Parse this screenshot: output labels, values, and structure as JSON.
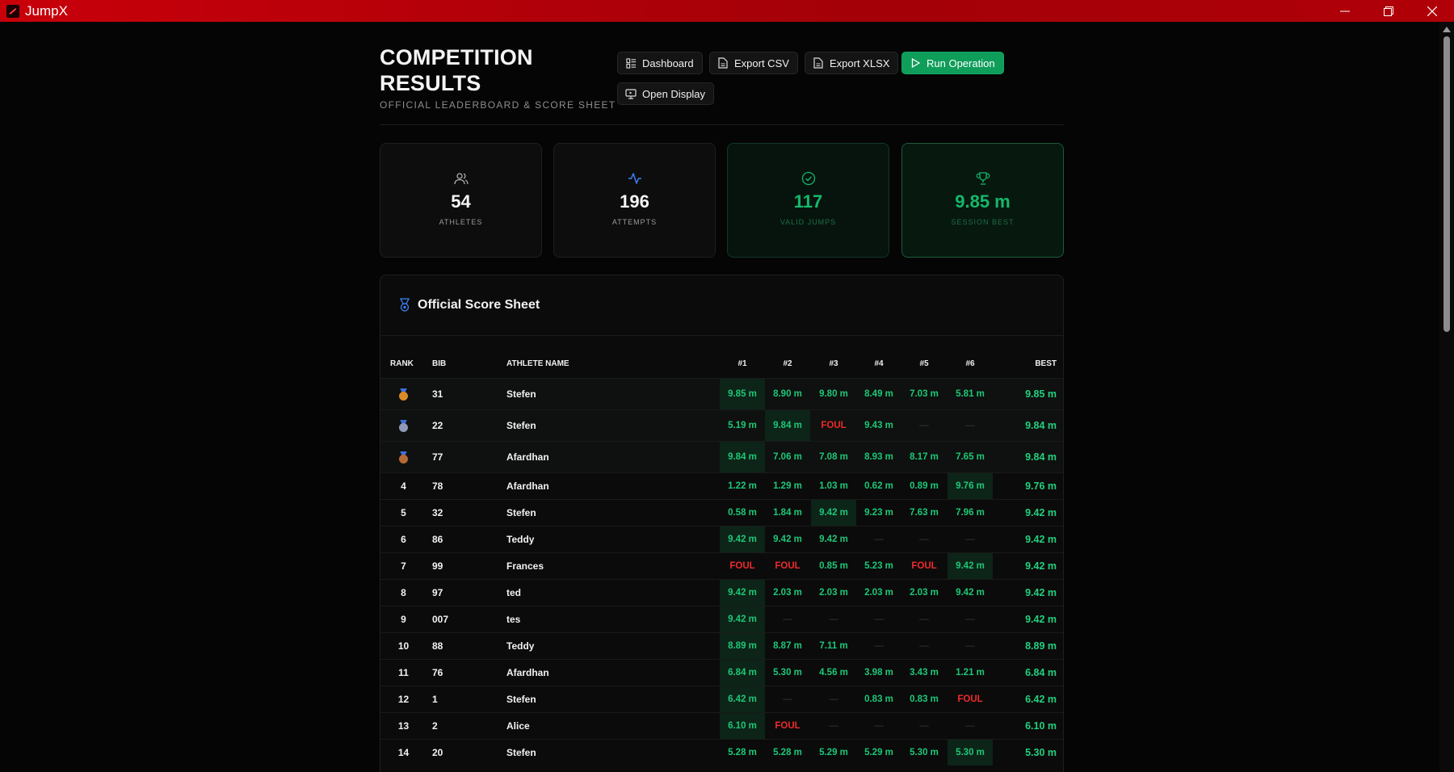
{
  "window": {
    "title": "JumpX",
    "minimize": "—",
    "maximize": "❐",
    "close": "✕"
  },
  "header": {
    "title": "COMPETITION RESULTS",
    "subtitle": "OFFICIAL LEADERBOARD & SCORE SHEET",
    "buttons": {
      "dashboard": "Dashboard",
      "export_csv": "Export CSV",
      "export_xlsx": "Export XLSX",
      "run_operation": "Run Operation",
      "open_display": "Open Display"
    }
  },
  "stats": [
    {
      "value": "54",
      "label": "ATHLETES",
      "icon": "users-icon"
    },
    {
      "value": "196",
      "label": "ATTEMPTS",
      "icon": "activity-icon"
    },
    {
      "value": "117",
      "label": "VALID JUMPS",
      "icon": "check-circle-icon"
    },
    {
      "value": "9.85 m",
      "label": "SESSION BEST",
      "icon": "trophy-icon"
    }
  ],
  "score_sheet": {
    "title": "Official Score Sheet",
    "columns": {
      "rank": "RANK",
      "bib": "BIB",
      "name": "ATHLETE NAME",
      "a1": "#1",
      "a2": "#2",
      "a3": "#3",
      "a4": "#4",
      "a5": "#5",
      "a6": "#6",
      "best": "BEST"
    },
    "medal_colors": {
      "gold": "#d98a2b",
      "silver": "#8f99b8",
      "bronze": "#b86a35",
      "ribbon": "#3f6fd8"
    },
    "rows": [
      {
        "rank": "",
        "medal": "gold",
        "bib": "31",
        "name": "Stefen",
        "attempts": [
          "9.85 m",
          "8.90 m",
          "9.80 m",
          "8.49 m",
          "7.03 m",
          "5.81 m"
        ],
        "best_index": 0,
        "best": "9.85 m"
      },
      {
        "rank": "",
        "medal": "silver",
        "bib": "22",
        "name": "Stefen",
        "attempts": [
          "5.19 m",
          "9.84 m",
          "FOUL",
          "9.43 m",
          "—",
          "—"
        ],
        "best_index": 1,
        "best": "9.84 m"
      },
      {
        "rank": "",
        "medal": "bronze",
        "bib": "77",
        "name": "Afardhan",
        "attempts": [
          "9.84 m",
          "7.06 m",
          "7.08 m",
          "8.93 m",
          "8.17 m",
          "7.65 m"
        ],
        "best_index": 0,
        "best": "9.84 m"
      },
      {
        "rank": "4",
        "bib": "78",
        "name": "Afardhan",
        "attempts": [
          "1.22 m",
          "1.29 m",
          "1.03 m",
          "0.62 m",
          "0.89 m",
          "9.76 m"
        ],
        "best_index": 5,
        "best": "9.76 m"
      },
      {
        "rank": "5",
        "bib": "32",
        "name": "Stefen",
        "attempts": [
          "0.58 m",
          "1.84 m",
          "9.42 m",
          "9.23 m",
          "7.63 m",
          "7.96 m"
        ],
        "best_index": 2,
        "best": "9.42 m"
      },
      {
        "rank": "6",
        "bib": "86",
        "name": "Teddy",
        "attempts": [
          "9.42 m",
          "9.42 m",
          "9.42 m",
          "—",
          "—",
          "—"
        ],
        "best_index": 0,
        "best": "9.42 m"
      },
      {
        "rank": "7",
        "bib": "99",
        "name": "Frances",
        "attempts": [
          "FOUL",
          "FOUL",
          "0.85 m",
          "5.23 m",
          "FOUL",
          "9.42 m"
        ],
        "best_index": 5,
        "best": "9.42 m"
      },
      {
        "rank": "8",
        "bib": "97",
        "name": "ted",
        "attempts": [
          "9.42 m",
          "2.03 m",
          "2.03 m",
          "2.03 m",
          "2.03 m",
          "9.42 m"
        ],
        "best_index": 0,
        "best": "9.42 m"
      },
      {
        "rank": "9",
        "bib": "007",
        "name": "tes",
        "attempts": [
          "9.42 m",
          "—",
          "—",
          "—",
          "—",
          "—"
        ],
        "best_index": 0,
        "best": "9.42 m"
      },
      {
        "rank": "10",
        "bib": "88",
        "name": "Teddy",
        "attempts": [
          "8.89 m",
          "8.87 m",
          "7.11 m",
          "—",
          "—",
          "—"
        ],
        "best_index": 0,
        "best": "8.89 m"
      },
      {
        "rank": "11",
        "bib": "76",
        "name": "Afardhan",
        "attempts": [
          "6.84 m",
          "5.30 m",
          "4.56 m",
          "3.98 m",
          "3.43 m",
          "1.21 m"
        ],
        "best_index": 0,
        "best": "6.84 m"
      },
      {
        "rank": "12",
        "bib": "1",
        "name": "Stefen",
        "attempts": [
          "6.42 m",
          "—",
          "—",
          "0.83 m",
          "0.83 m",
          "FOUL"
        ],
        "best_index": 0,
        "best": "6.42 m"
      },
      {
        "rank": "13",
        "bib": "2",
        "name": "Alice",
        "attempts": [
          "6.10 m",
          "FOUL",
          "—",
          "—",
          "—",
          "—"
        ],
        "best_index": 0,
        "best": "6.10 m"
      },
      {
        "rank": "14",
        "bib": "20",
        "name": "Stefen",
        "attempts": [
          "5.28 m",
          "5.28 m",
          "5.29 m",
          "5.29 m",
          "5.30 m",
          "5.30 m"
        ],
        "best_index": 5,
        "best": "5.30 m"
      }
    ]
  }
}
